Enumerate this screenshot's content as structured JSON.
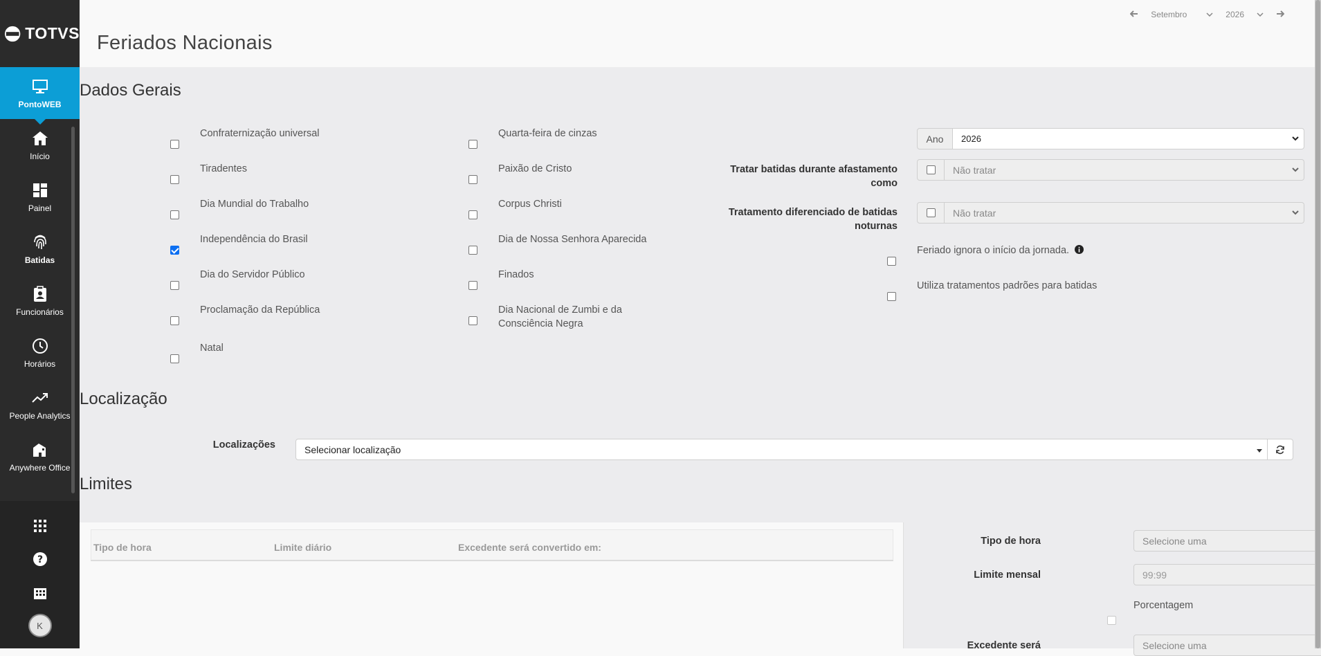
{
  "brand": {
    "name": "TOTVS"
  },
  "sidebar": {
    "items": [
      {
        "label": "PontoWEB",
        "icon": "monitor-icon"
      },
      {
        "label": "Início",
        "icon": "home-icon"
      },
      {
        "label": "Painel",
        "icon": "dashboard-icon"
      },
      {
        "label": "Batidas",
        "icon": "fingerprint-icon"
      },
      {
        "label": "Funcionários",
        "icon": "badge-icon"
      },
      {
        "label": "Horários",
        "icon": "clock-icon"
      },
      {
        "label": "People Analytics",
        "icon": "trending-up-icon"
      },
      {
        "label": "Anywhere Office",
        "icon": "remote-office-icon"
      }
    ],
    "bottom": [
      {
        "icon": "apps-grid-icon"
      },
      {
        "icon": "help-icon"
      },
      {
        "icon": "building-icon"
      }
    ],
    "avatar_initial": "K"
  },
  "header": {
    "title": "Feriados Nacionais",
    "period": {
      "month": "Setembro",
      "year": "2026"
    }
  },
  "sections": {
    "general": "Dados Gerais",
    "location": "Localização",
    "limits": "Limites"
  },
  "holidays_col1": [
    {
      "label": "Confraternização universal",
      "checked": false
    },
    {
      "label": "Tiradentes",
      "checked": false
    },
    {
      "label": "Dia Mundial do Trabalho",
      "checked": false
    },
    {
      "label": "Independência do Brasil",
      "checked": true
    },
    {
      "label": "Dia do Servidor Público",
      "checked": false
    },
    {
      "label": "Proclamação da República",
      "checked": false
    },
    {
      "label": "Natal",
      "checked": false
    }
  ],
  "holidays_col2": [
    {
      "label": "Quarta-feira de cinzas",
      "checked": false
    },
    {
      "label": "Paixão de Cristo",
      "checked": false
    },
    {
      "label": "Corpus Christi",
      "checked": false
    },
    {
      "label": "Dia de Nossa Senhora Aparecida",
      "checked": false
    },
    {
      "label": "Finados",
      "checked": false
    },
    {
      "label": "Dia Nacional de Zumbi e da Consciência Negra",
      "checked": false
    }
  ],
  "options": {
    "year_addon": "Ano",
    "year_value": "2026",
    "absence_label": "Tratar batidas durante afastamento como",
    "absence_value": "Não tratar",
    "night_label": "Tratamento diferenciado de batidas noturnas",
    "night_value": "Não tratar",
    "ignore_start": "Feriado ignora o início da jornada.",
    "use_default": "Utiliza tratamentos padrões para batidas"
  },
  "location": {
    "label": "Localizações",
    "placeholder": "Selecionar localização"
  },
  "limits": {
    "columns": [
      "Tipo de hora",
      "Limite diário",
      "Excedente será convertido em:"
    ],
    "form": {
      "hour_type_label": "Tipo de hora",
      "hour_type_value": "Selecione uma",
      "monthly_label": "Limite mensal",
      "monthly_placeholder": "99:99",
      "percent_label": "Porcentagem",
      "excess_label": "Excedente será",
      "excess_value": "Selecione uma"
    }
  },
  "colors": {
    "accent": "#0c9ed6",
    "sidebar": "#2b2b2b"
  }
}
